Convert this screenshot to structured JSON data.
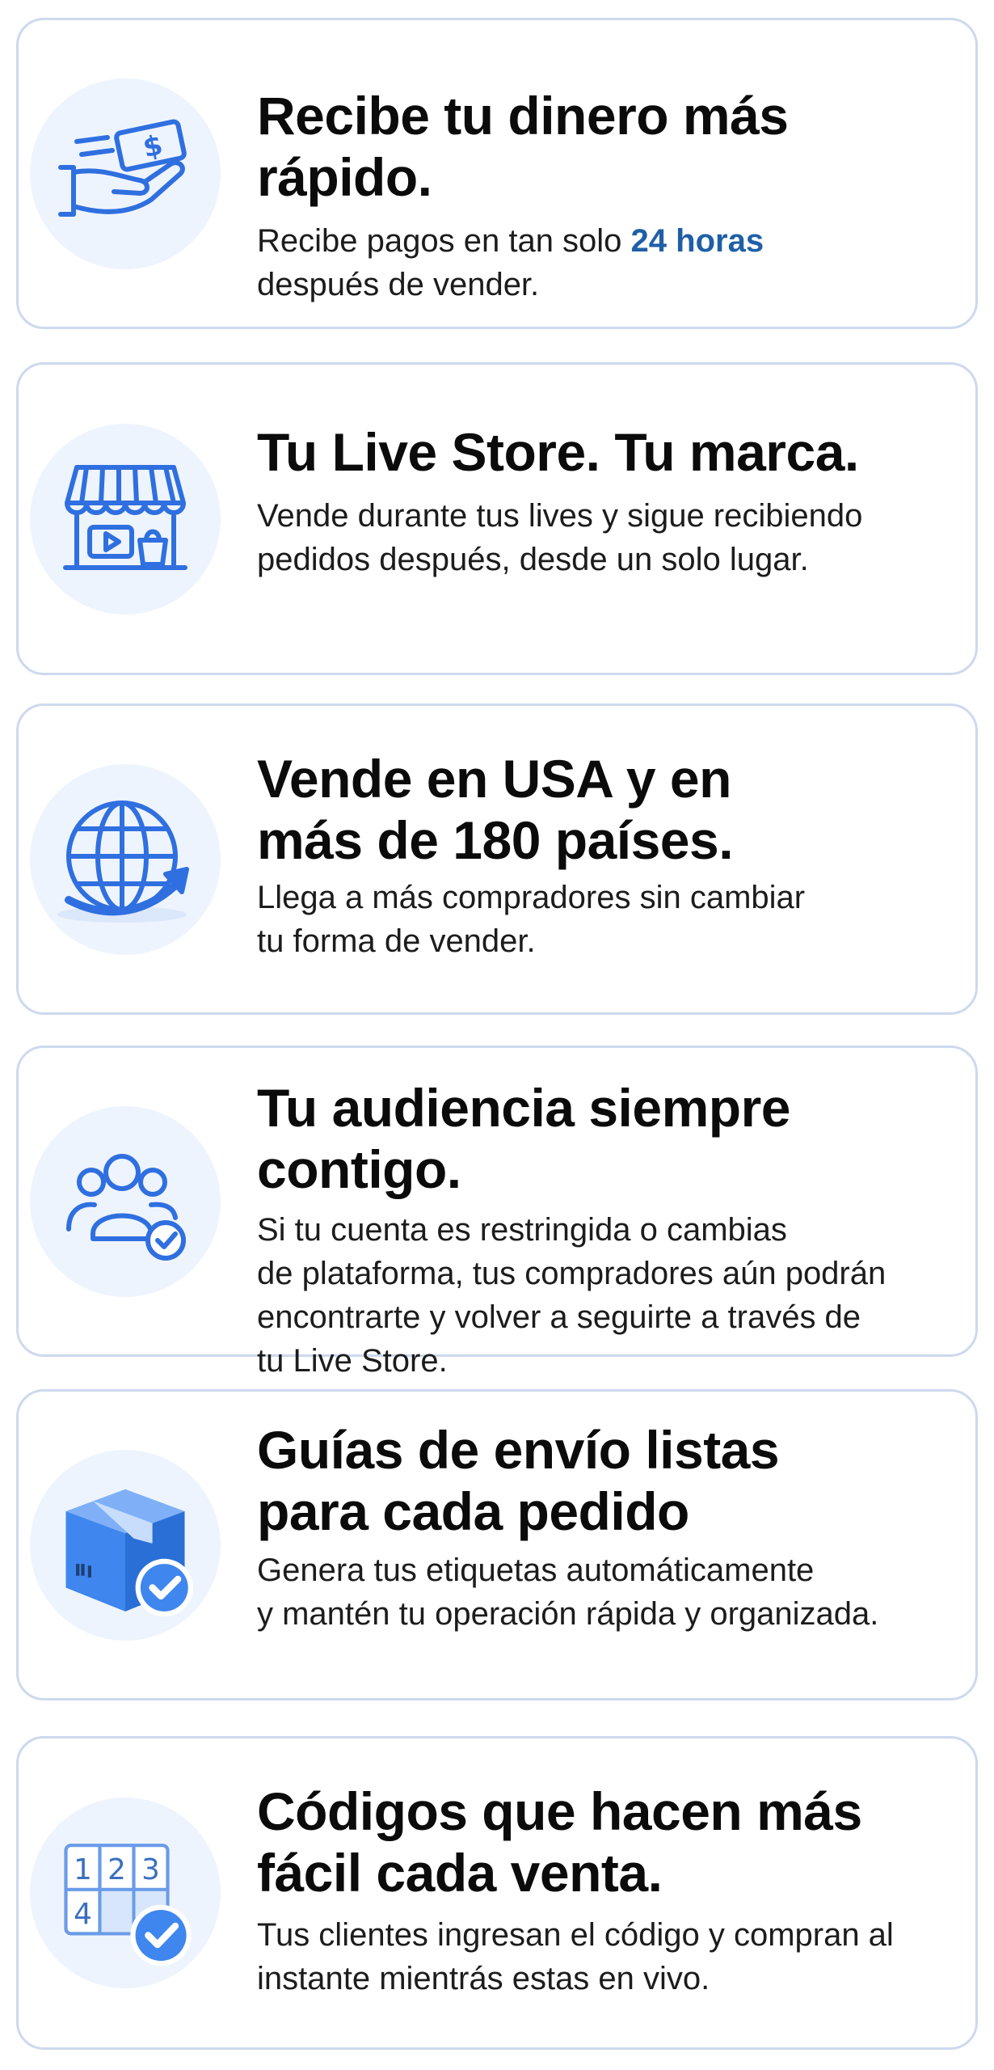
{
  "cards": [
    {
      "title": "Recibe tu dinero más rápido.",
      "desc_before": "Recibe pagos en tan solo ",
      "desc_highlight": "24 horas",
      "desc_after": "después de vender.",
      "icon": "hand-money-icon"
    },
    {
      "title": "Tu Live Store. Tu marca.",
      "desc_lines": [
        "Vende durante tus lives y sigue recibiendo",
        "pedidos después, desde un solo lugar."
      ],
      "icon": "storefront-icon"
    },
    {
      "title_lines": [
        "Vende en USA y en",
        "más de 180 países."
      ],
      "desc_lines": [
        "Llega a más compradores sin cambiar",
        "tu forma de vender."
      ],
      "icon": "globe-icon"
    },
    {
      "title": "Tu audiencia siempre contigo.",
      "desc_lines": [
        "Si tu cuenta es restringida o cambias",
        "de plataforma, tus compradores aún podrán",
        "encontrarte y volver a seguirte a través de",
        "tu Live Store."
      ],
      "icon": "audience-check-icon"
    },
    {
      "title_lines": [
        "Guías de envío listas",
        "para cada pedido"
      ],
      "desc_lines": [
        "Genera tus etiquetas automáticamente",
        "y mantén tu operación rápida y organizada."
      ],
      "icon": "package-check-icon"
    },
    {
      "title_lines": [
        "Códigos que hacen más",
        "fácil cada venta."
      ],
      "desc_lines": [
        "Tus clientes ingresan el código y compran al",
        "instante mientrás estas en vivo."
      ],
      "icon": "number-grid-check-icon",
      "grid_digits": [
        "1",
        "2",
        "3",
        "4"
      ]
    }
  ],
  "colors": {
    "accent": "#1f5fa6",
    "icon_blue": "#2f6fe0",
    "card_border": "#cdd9ee",
    "icon_bg": "#eef4fd"
  }
}
